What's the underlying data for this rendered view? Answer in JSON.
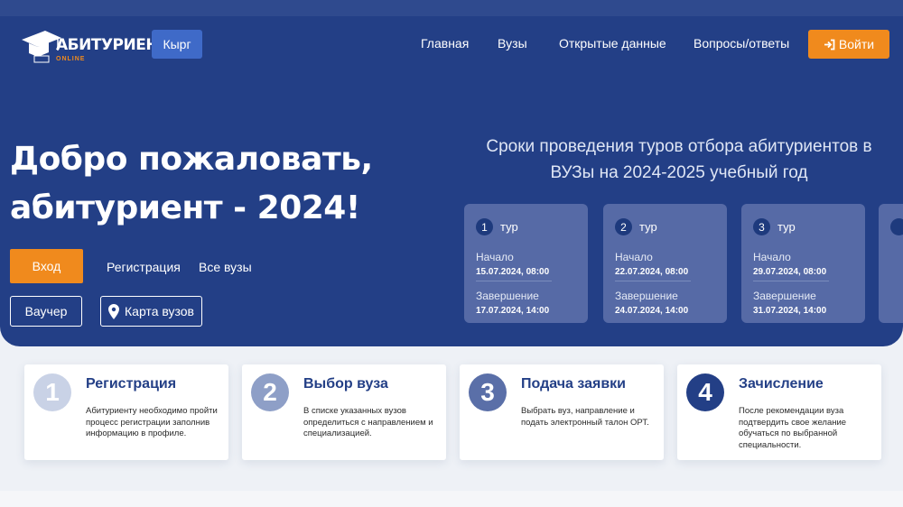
{
  "header": {
    "logo_text": "АБИТУРИЕНТ",
    "logo_sub": "ONLINE",
    "lang_button": "Кырг",
    "nav": [
      "Главная",
      "Вузы",
      "Открытые данные",
      "Вопросы/ответы"
    ],
    "login": "Войти"
  },
  "hero": {
    "welcome_line1": "Добро пожаловать,",
    "welcome_line2": "абитуриент - 2024!",
    "enter": "Вход",
    "register": "Регистрация",
    "all_unis": "Все вузы",
    "voucher": "Ваучер",
    "map": "Карта вузов"
  },
  "tours": {
    "title": "Сроки проведения туров отбора абитуриентов в ВУЗы на 2024-2025 учебный год",
    "tour_word": "тур",
    "start_label": "Начало",
    "end_label": "Завершение",
    "items": [
      {
        "num": "1",
        "start": "15.07.2024,  08:00",
        "end": "17.07.2024,  14:00"
      },
      {
        "num": "2",
        "start": "22.07.2024,  08:00",
        "end": "24.07.2024,  14:00"
      },
      {
        "num": "3",
        "start": "29.07.2024,  08:00",
        "end": "31.07.2024,  14:00"
      }
    ]
  },
  "steps": [
    {
      "num": "1",
      "title": "Регистрация",
      "desc": "Абитуриенту необходимо пройти процесс регистрации заполнив информацию в профиле.",
      "color": "#c9d2e6"
    },
    {
      "num": "2",
      "title": "Выбор вуза",
      "desc": "В списке указанных вузов определиться с направлением и специализацией.",
      "color": "#8e9fc7"
    },
    {
      "num": "3",
      "title": "Подача заявки",
      "desc": "Выбрать вуз, направление и подать электронный талон ОРТ.",
      "color": "#5a6fa8"
    },
    {
      "num": "4",
      "title": "Зачисление",
      "desc": "После рекомендации вуза подтвердить свое желание обучаться по выбранной специальности.",
      "color": "#233f86"
    }
  ],
  "colors": {
    "primary": "#233f86",
    "accent": "#f08a1d",
    "card": "#566aa6"
  }
}
